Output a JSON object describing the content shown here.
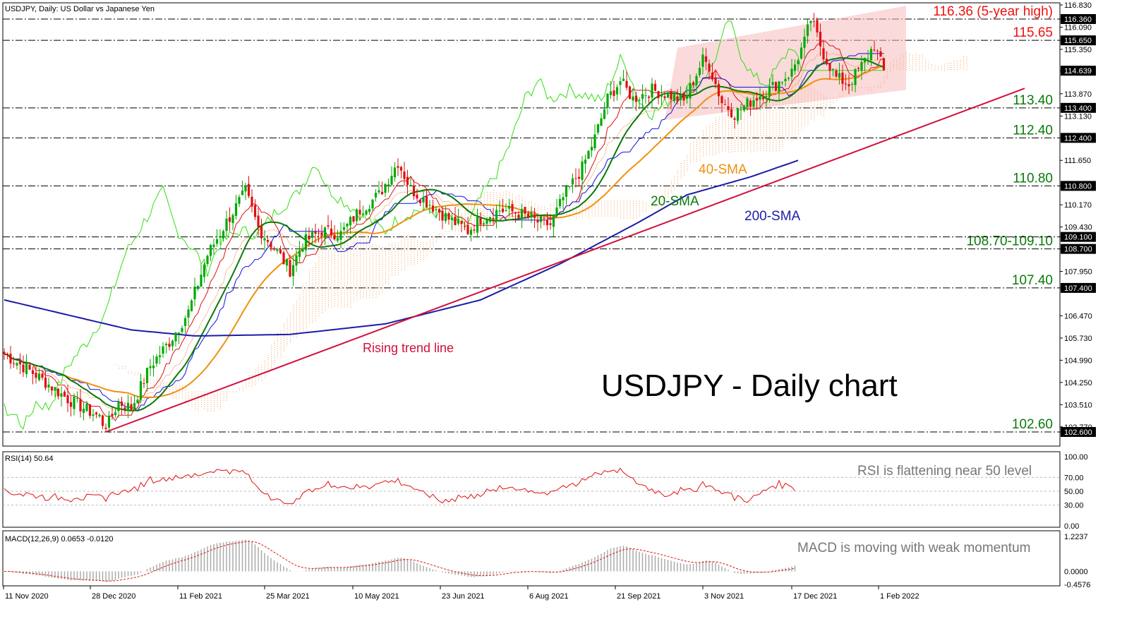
{
  "header": "USDJPY, Daily:  US Dollar vs Japanese Yen",
  "big_title": "USDJPY - Daily chart",
  "colors": {
    "bull": "#00aa00",
    "bear": "#e01010",
    "sma20": "#0a7a0a",
    "sma40": "#f09010",
    "sma200": "#1c1ca8",
    "trend": "#d0103a",
    "tenkan": "#e01010",
    "kijun": "#1010e0",
    "chikou": "#33dd11",
    "cloud": "#f0a060",
    "channel": "#f6bcbc",
    "level": "#0a7a0a",
    "level_red": "#ee1111"
  },
  "main_axis": {
    "ticks": [
      "116.830",
      "116.360",
      "116.090",
      "115.650",
      "115.350",
      "114.639",
      "113.870",
      "113.400",
      "113.130",
      "112.400",
      "111.650",
      "110.800",
      "110.170",
      "109.430",
      "109.100",
      "108.700",
      "107.950",
      "107.400",
      "106.470",
      "105.730",
      "104.990",
      "104.250",
      "103.510",
      "102.770",
      "102.600"
    ],
    "boxed": [
      "116.360",
      "115.650",
      "114.639",
      "113.400",
      "112.400",
      "110.800",
      "109.100",
      "108.700",
      "107.400",
      "102.600"
    ]
  },
  "x_axis": [
    "11 Nov 2020",
    "28 Dec 2020",
    "11 Feb 2021",
    "25 Mar 2021",
    "10 May 2021",
    "23 Jun 2021",
    "6 Aug 2021",
    "21 Sep 2021",
    "3 Nov 2021",
    "17 Dec 2021",
    "1 Feb 2022"
  ],
  "levels": [
    {
      "label": "116.36 (5-year high)",
      "price": 116.36,
      "red": true
    },
    {
      "label": "115.65",
      "price": 115.65,
      "red": true
    },
    {
      "label": "113.40",
      "price": 113.4,
      "red": false
    },
    {
      "label": "112.40",
      "price": 112.4,
      "red": false
    },
    {
      "label": "110.80",
      "price": 110.8,
      "red": false
    },
    {
      "label": "108.70-109.10",
      "price": 108.7,
      "red": false
    },
    {
      "label": "107.40",
      "price": 107.4,
      "red": false
    },
    {
      "label": "102.60",
      "price": 102.6,
      "red": false
    }
  ],
  "annotations": {
    "sma40": "40-SMA",
    "sma20": "20-SMA",
    "sma200": "200-SMA",
    "trend": "Rising trend line"
  },
  "rsi": {
    "title": "RSI(14) 50.64",
    "note": "RSI is flattening near 50 level",
    "ticks": [
      "100.00",
      "70.00",
      "50.00",
      "30.00",
      "0.00"
    ]
  },
  "macd": {
    "title": "MACD(12,26,9) 0.0653 -0.0120",
    "note": "MACD is moving with weak momentum",
    "ticks": [
      "1.2237",
      "0.0000",
      "-0.4576"
    ]
  },
  "chart_data": {
    "type": "candlestick",
    "symbol": "USDJPY",
    "timeframe": "Daily",
    "ylim": [
      102.6,
      116.83
    ],
    "x_range": [
      "11 Nov 2020",
      "1 Feb 2022"
    ],
    "close_path": [
      [
        0,
        105.2
      ],
      [
        10,
        104.5
      ],
      [
        20,
        103.7
      ],
      [
        30,
        103.1
      ],
      [
        32,
        102.7
      ],
      [
        36,
        103.6
      ],
      [
        40,
        103.4
      ],
      [
        46,
        104.8
      ],
      [
        52,
        105.6
      ],
      [
        58,
        106.6
      ],
      [
        64,
        108.5
      ],
      [
        70,
        109.6
      ],
      [
        76,
        110.6
      ],
      [
        80,
        109.4
      ],
      [
        86,
        108.6
      ],
      [
        90,
        108.0
      ],
      [
        94,
        108.9
      ],
      [
        100,
        109.3
      ],
      [
        106,
        109.2
      ],
      [
        112,
        110.0
      ],
      [
        118,
        110.5
      ],
      [
        124,
        111.6
      ],
      [
        128,
        110.7
      ],
      [
        134,
        110.2
      ],
      [
        140,
        109.7
      ],
      [
        146,
        109.3
      ],
      [
        150,
        109.7
      ],
      [
        156,
        110.0
      ],
      [
        162,
        109.9
      ],
      [
        168,
        109.6
      ],
      [
        172,
        109.5
      ],
      [
        176,
        110.4
      ],
      [
        182,
        111.4
      ],
      [
        186,
        112.4
      ],
      [
        190,
        113.7
      ],
      [
        194,
        114.3
      ],
      [
        198,
        113.7
      ],
      [
        204,
        114.0
      ],
      [
        210,
        113.8
      ],
      [
        214,
        113.6
      ],
      [
        220,
        115.0
      ],
      [
        222,
        114.8
      ],
      [
        226,
        113.6
      ],
      [
        230,
        113.2
      ],
      [
        236,
        113.7
      ],
      [
        242,
        114.1
      ],
      [
        248,
        114.6
      ],
      [
        252,
        115.6
      ],
      [
        254,
        116.36
      ],
      [
        258,
        115.2
      ],
      [
        262,
        114.4
      ],
      [
        266,
        114.2
      ],
      [
        270,
        114.8
      ],
      [
        274,
        115.5
      ],
      [
        277,
        114.6
      ]
    ],
    "indicators": [
      "SMA 20",
      "SMA 40",
      "SMA 200",
      "Ichimoku",
      "Rising trend line"
    ],
    "rsi_last": 50.64,
    "macd_last": [
      0.0653,
      -0.012
    ]
  }
}
